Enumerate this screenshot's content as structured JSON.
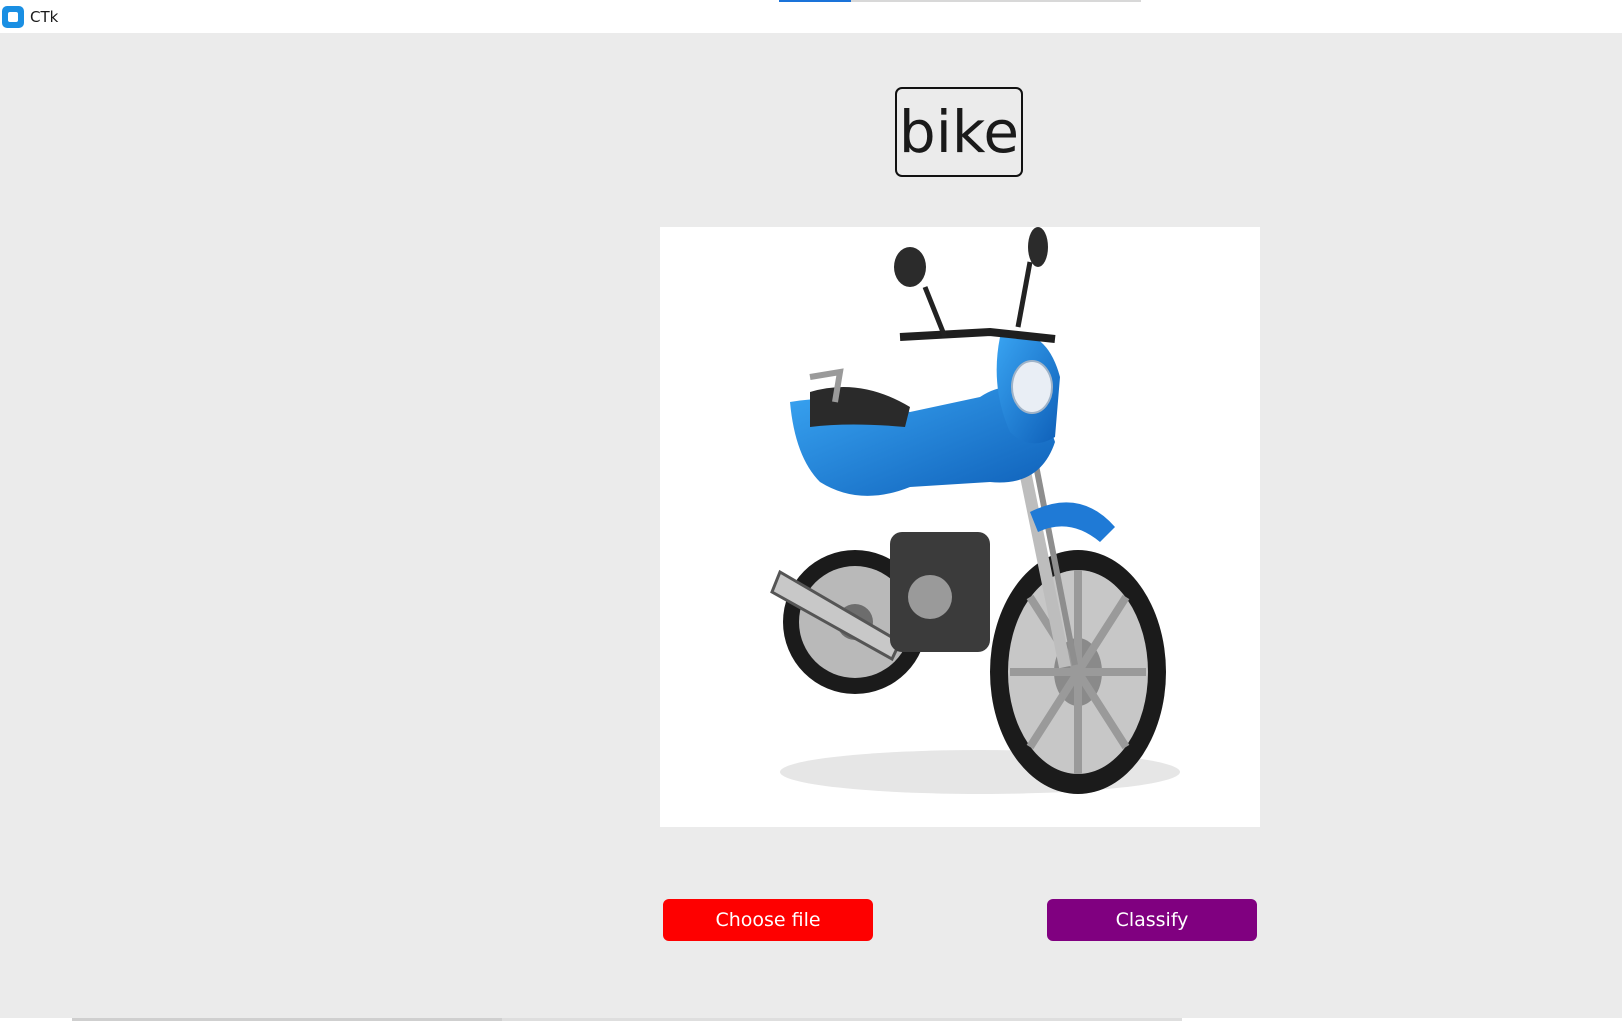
{
  "window": {
    "title": "CTk",
    "icon": "app-icon",
    "accent_color": "#1a8fe3"
  },
  "progress": {
    "value": 0.2
  },
  "result": {
    "label": "bike"
  },
  "image_panel": {
    "content": "blue motorcycle photo"
  },
  "buttons": {
    "choose_file": {
      "label": "Choose file",
      "color": "#fe0000"
    },
    "classify": {
      "label": "Classify",
      "color": "#800080"
    }
  }
}
